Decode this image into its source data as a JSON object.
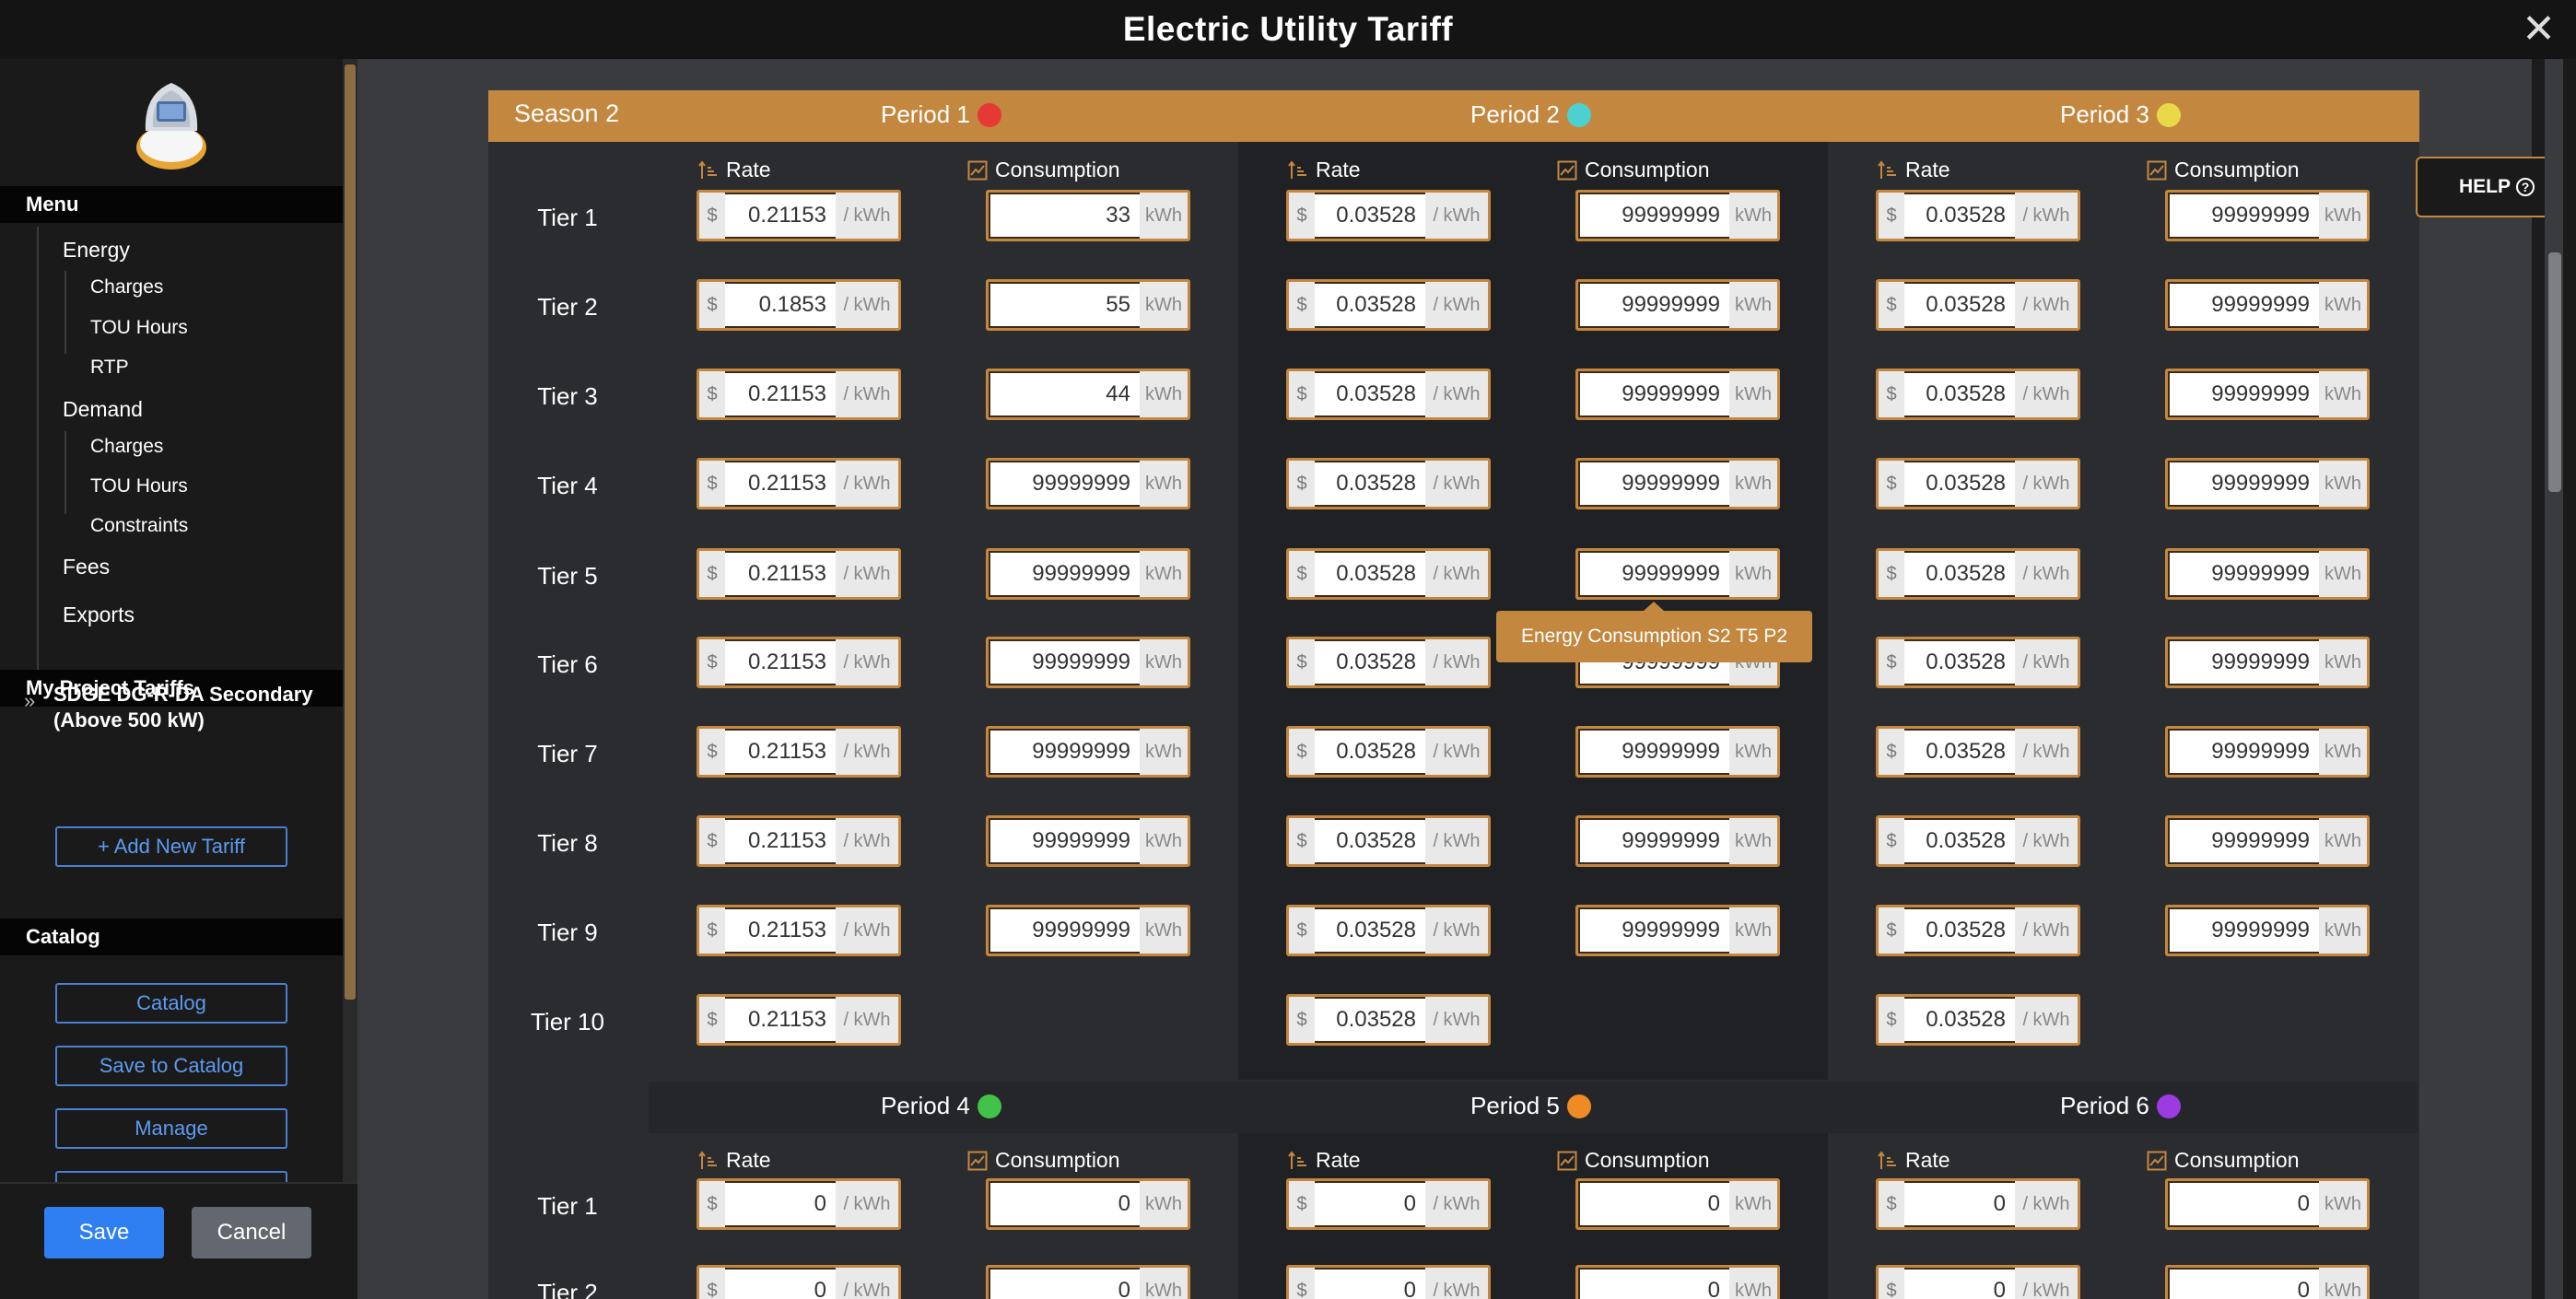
{
  "window": {
    "title": "Electric Utility Tariff"
  },
  "sidebar": {
    "menu_title": "Menu",
    "energy": {
      "label": "Energy",
      "items": [
        "Charges",
        "TOU Hours",
        "RTP"
      ]
    },
    "demand": {
      "label": "Demand",
      "items": [
        "Charges",
        "TOU Hours",
        "Constraints"
      ]
    },
    "fees": "Fees",
    "exports": "Exports",
    "project_tariffs_title": "My Project Tariffs",
    "tariff_name": "SDGE DG-R-DA Secondary (Above 500 kW)",
    "add_tariff": "+ Add New Tariff",
    "catalog_title": "Catalog",
    "catalog_buttons": [
      "Catalog",
      "Save to Catalog",
      "Manage"
    ],
    "save": "Save",
    "cancel": "Cancel"
  },
  "help": "HELP",
  "season": "Season 2",
  "periods_top": [
    {
      "label": "Period 1",
      "color": "#e53935"
    },
    {
      "label": "Period 2",
      "color": "#4dd0d0"
    },
    {
      "label": "Period 3",
      "color": "#e8d84a"
    }
  ],
  "periods_bottom": [
    {
      "label": "Period 4",
      "color": "#43c24a"
    },
    {
      "label": "Period 5",
      "color": "#f08a24"
    },
    {
      "label": "Period 6",
      "color": "#9c3be0"
    }
  ],
  "col_labels": {
    "rate": "Rate",
    "consumption": "Consumption"
  },
  "units": {
    "currency": "$",
    "rate": "/ kWh",
    "consumption": "kWh"
  },
  "tiers": [
    "Tier 1",
    "Tier 2",
    "Tier 3",
    "Tier 4",
    "Tier 5",
    "Tier 6",
    "Tier 7",
    "Tier 8",
    "Tier 9",
    "Tier 10"
  ],
  "tiers_bottom": [
    "Tier 1",
    "Tier 2"
  ],
  "tooltip": "Energy Consumption S2 T5 P2",
  "rates": {
    "p1": [
      "0.21153",
      "0.1853",
      "0.21153",
      "0.21153",
      "0.21153",
      "0.21153",
      "0.21153",
      "0.21153",
      "0.21153",
      "0.21153"
    ],
    "p2": [
      "0.03528",
      "0.03528",
      "0.03528",
      "0.03528",
      "0.03528",
      "0.03528",
      "0.03528",
      "0.03528",
      "0.03528",
      "0.03528"
    ],
    "p3": [
      "0.03528",
      "0.03528",
      "0.03528",
      "0.03528",
      "0.03528",
      "0.03528",
      "0.03528",
      "0.03528",
      "0.03528",
      "0.03528"
    ]
  },
  "consumption": {
    "p1": [
      "33",
      "55",
      "44",
      "99999999",
      "99999999",
      "99999999",
      "99999999",
      "99999999",
      "99999999"
    ],
    "p2": [
      "99999999",
      "99999999",
      "99999999",
      "99999999",
      "99999999",
      "99999999",
      "99999999",
      "99999999",
      "99999999"
    ],
    "p3": [
      "99999999",
      "99999999",
      "99999999",
      "99999999",
      "99999999",
      "99999999",
      "99999999",
      "99999999",
      "99999999"
    ]
  },
  "bottom_values": {
    "rate": "0",
    "consumption": "0"
  }
}
